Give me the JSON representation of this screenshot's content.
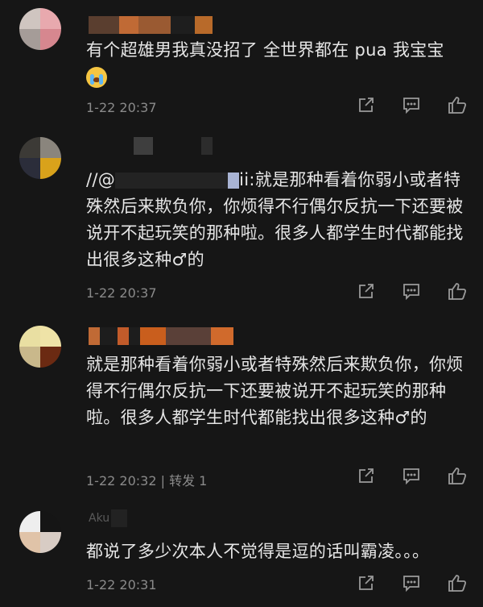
{
  "comments": [
    {
      "content": "有个超雄男我真没招了 全世界都在 pua 我宝宝",
      "emoji": "loudly-crying-face",
      "time": "1-22 20:37",
      "forward": ""
    },
    {
      "reply_prefix": "//@",
      "reply_suffix": "ii:",
      "content": "就是那种看着你弱小或者特殊然后来欺负你，你烦得不行偶尔反抗一下还要被说开不起玩笑的那种啦。很多人都学生时代都能找出很多这种♂的",
      "time": "1-22 20:37",
      "forward": ""
    },
    {
      "content": "就是那种看着你弱小或者特殊然后来欺负你，你烦得不行偶尔反抗一下还要被说开不起玩笑的那种啦。很多人都学生时代都能找出很多这种♂的",
      "time": "1-22 20:32",
      "forward": "| 转发 1"
    },
    {
      "username_partial": "Aku",
      "content": "都说了多少次本人不觉得是逗的话叫霸凌。。。",
      "time": "1-22 20:31",
      "forward": ""
    }
  ],
  "icons": [
    "forward-icon",
    "comment-icon",
    "like-icon"
  ],
  "colors": {
    "background": "#161616",
    "text": "#e6e6e6",
    "meta": "#8a8a8a",
    "icon": "#9a9a9a"
  }
}
